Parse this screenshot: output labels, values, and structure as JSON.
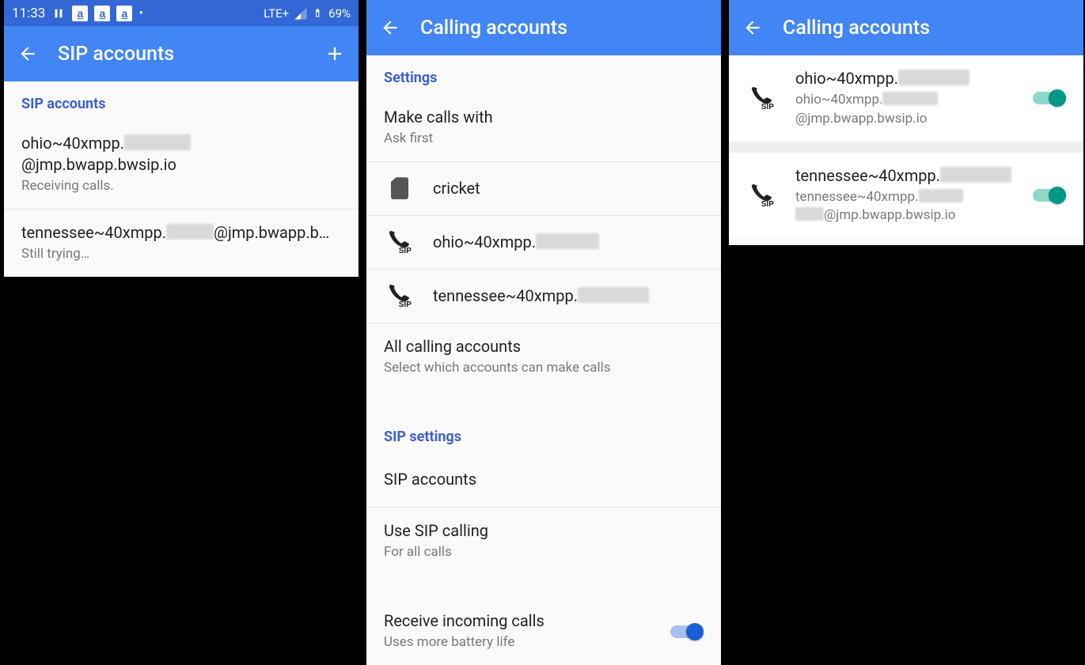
{
  "status": {
    "time": "11:33",
    "lte": "LTE+",
    "battery": "69%"
  },
  "p1": {
    "title": "SIP accounts",
    "section": "SIP accounts",
    "accounts": [
      {
        "prefix": "ohio~40xmpp.",
        "suffix": "@jmp.bwapp.bwsip.io",
        "status": "Receiving calls."
      },
      {
        "prefix": "tennessee~40xmpp.",
        "suffix": "@jmp.bwapp.b…",
        "status": "Still trying…"
      }
    ]
  },
  "p2": {
    "title": "Calling accounts",
    "section1": "Settings",
    "make_calls": {
      "title": "Make calls with",
      "sub": "Ask first"
    },
    "carrier": "cricket",
    "acct1_prefix": "ohio~40xmpp.",
    "acct2_prefix": "tennessee~40xmpp.",
    "all_accounts": {
      "title": "All calling accounts",
      "sub": "Select which accounts can make calls"
    },
    "section2": "SIP settings",
    "sip_accounts": "SIP accounts",
    "use_sip": {
      "title": "Use SIP calling",
      "sub": "For all calls"
    },
    "receive": {
      "title": "Receive incoming calls",
      "sub": "Uses more battery life"
    }
  },
  "p3": {
    "title": "Calling accounts",
    "accounts": [
      {
        "title_prefix": "ohio~40xmpp.",
        "sub_prefix": "ohio~40xmpp.",
        "sub_suffix": "@jmp.bwapp.bwsip.io"
      },
      {
        "title_prefix": "tennessee~40xmpp.",
        "sub_prefix": "tennessee~40xmpp.",
        "sub_suffix": "@jmp.bwapp.bwsip.io"
      }
    ]
  }
}
